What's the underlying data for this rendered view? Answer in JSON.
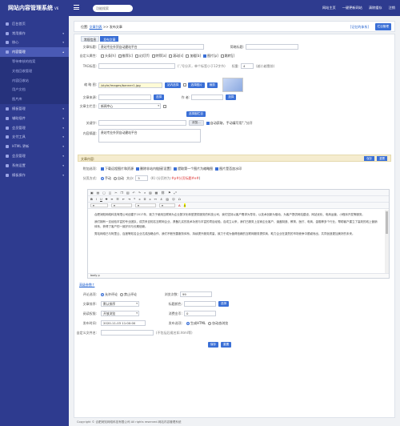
{
  "header": {
    "brand": "网站内容管理系统",
    "version": "V6",
    "search_placeholder": "功能搜索",
    "links": [
      "网站主页",
      "一键更新网站",
      "清除缓存",
      "注销"
    ]
  },
  "sidebar": {
    "items": [
      {
        "label": "后台首页"
      },
      {
        "label": "常用操作"
      },
      {
        "label": "核心"
      },
      {
        "label": "内容管理"
      },
      {
        "label": "等待审核的档案"
      },
      {
        "label": "文档回收管理"
      },
      {
        "label": "内容回收站"
      },
      {
        "label": "用户文档"
      },
      {
        "label": "图片库"
      },
      {
        "label": "模板管理"
      },
      {
        "label": "辅助插件"
      },
      {
        "label": "会员管理"
      },
      {
        "label": "支付工具"
      },
      {
        "label": "HTML 更新"
      },
      {
        "label": "会员管理"
      },
      {
        "label": "系统设置"
      },
      {
        "label": "模板操作"
      }
    ]
  },
  "breadcrumb": {
    "prefix": "位置:",
    "link": "文章列表",
    "sep": ">>",
    "current": "发布文章",
    "right_link": "[记忆的体系]",
    "right_button": "栏目管理"
  },
  "tabs": [
    "常规信息",
    "发布文章"
  ],
  "form": {
    "title_label": "文章标题:",
    "title_value": "贵站专业外贸自动建站平台",
    "short_title_label": "简略标题:",
    "attr_label": "自定义属性:",
    "attrs": [
      "头条[h]",
      "推荐[c]",
      "幻灯[f]",
      "特荐[a]",
      "滚动[s]",
      "加粗[b]",
      "图片[p]",
      "跳转[j]"
    ],
    "tag_label": "TAG标签:",
    "tag_note": "(','号分开，单个标签小于12字节)",
    "weight_label": "权重:",
    "weight_value": "4",
    "weight_note": "(越小越靠前)",
    "thumb_label": "缩 略 图:",
    "thumb_value": "/style/images/banner1.jpg",
    "thumb_btn1": "站内选择",
    "thumb_btn2": "选择图片",
    "thumb_btn3": "裁剪",
    "source_label": "文章来源:",
    "source_btn": "选择",
    "author_label": "作 者:",
    "author_btn": "选择",
    "column_label": "文章主栏目:",
    "column_value": "新闻中心",
    "column_btn": "选择副栏目",
    "keywords_label": "关键字:",
    "keywords_btn": "浏览...",
    "keywords_auto": "自动获取，手动填写用\",\"分开",
    "summary_label": "内容摘要:",
    "summary_value": "贵站专业外贸自动建站平台",
    "content_section": "文章内容:",
    "section_btn1": "保存",
    "section_btn2": "重置",
    "extra_label": "附加选项:",
    "extra_opts": [
      "下载远程图片和资源",
      "删除非站内链接[设置]",
      "提取第一个图片为缩略图",
      "图片是否加水印"
    ],
    "page_label": "分页方式:",
    "page_opts": [
      "手动",
      "自动"
    ],
    "page_size_label": "大小:",
    "page_size": "5",
    "page_note": "(K) (分页符为:",
    "page_tag": "#p#分页标题#e#",
    "page_note_end": ")",
    "editor_status": "body p",
    "editor_paragraphs": [
      "合肥润知网络科技有限公司创建于2017年，致力于使用互联网为企业数字化转型提供服务的科技公司，我们坚持以客户需求为导向，以技术创新为驱动，为客户提供网站建设、网站优化、电商运营、小程序开发等服务。",
      "我们拥有一支经验丰富的专业团队，成员来自知名互联网企业，具备扎实的技术功底与丰富的项目经验。自成立以来，我们已服务上百家企业客户，涵盖制造、教育、医疗、电商、金融等多个行业，帮助客户建立了高效的线上营销体系，获得了客户的一致好评与长期信赖。",
      "秀站网络已与阿里云、百度等知名企业达成战略合作，我们不断完善服务体系，持续提升服务质量，致力于成为值得信赖的互联网服务提供商，助力企业在激烈的市场竞争中脱颖而出，共同创造更加美好的未来。"
    ],
    "advanced_label": "高级参数↑",
    "comment_label": "评论选项:",
    "comment_opts": [
      "允许评论",
      "禁止评论"
    ],
    "views_label": "浏览次数:",
    "views_value": "99",
    "type_label": "文章排序:",
    "type_value": "默认排序",
    "tpl_label": "标题颜色:",
    "tpl_btn": "选择",
    "read_label": "阅读权限:",
    "read_value": "开放浏览",
    "cost_label": "消费金币:",
    "cost_value": "0",
    "pubtime_label": "发布时间:",
    "pubtime_value": "2020-11-03 11:00:00",
    "choice_label": "发布选项:",
    "choice_opts": [
      "生成HTML",
      "仅动态浏览"
    ],
    "filename_label": "自定义文件名:",
    "filename_note": "(不包括后缀名如.html等)",
    "submit": "保存",
    "reset": "重置"
  },
  "footer": "Copyright © 合肥润知网络科技有限公司 All rights reserved.网站内容管理系统"
}
